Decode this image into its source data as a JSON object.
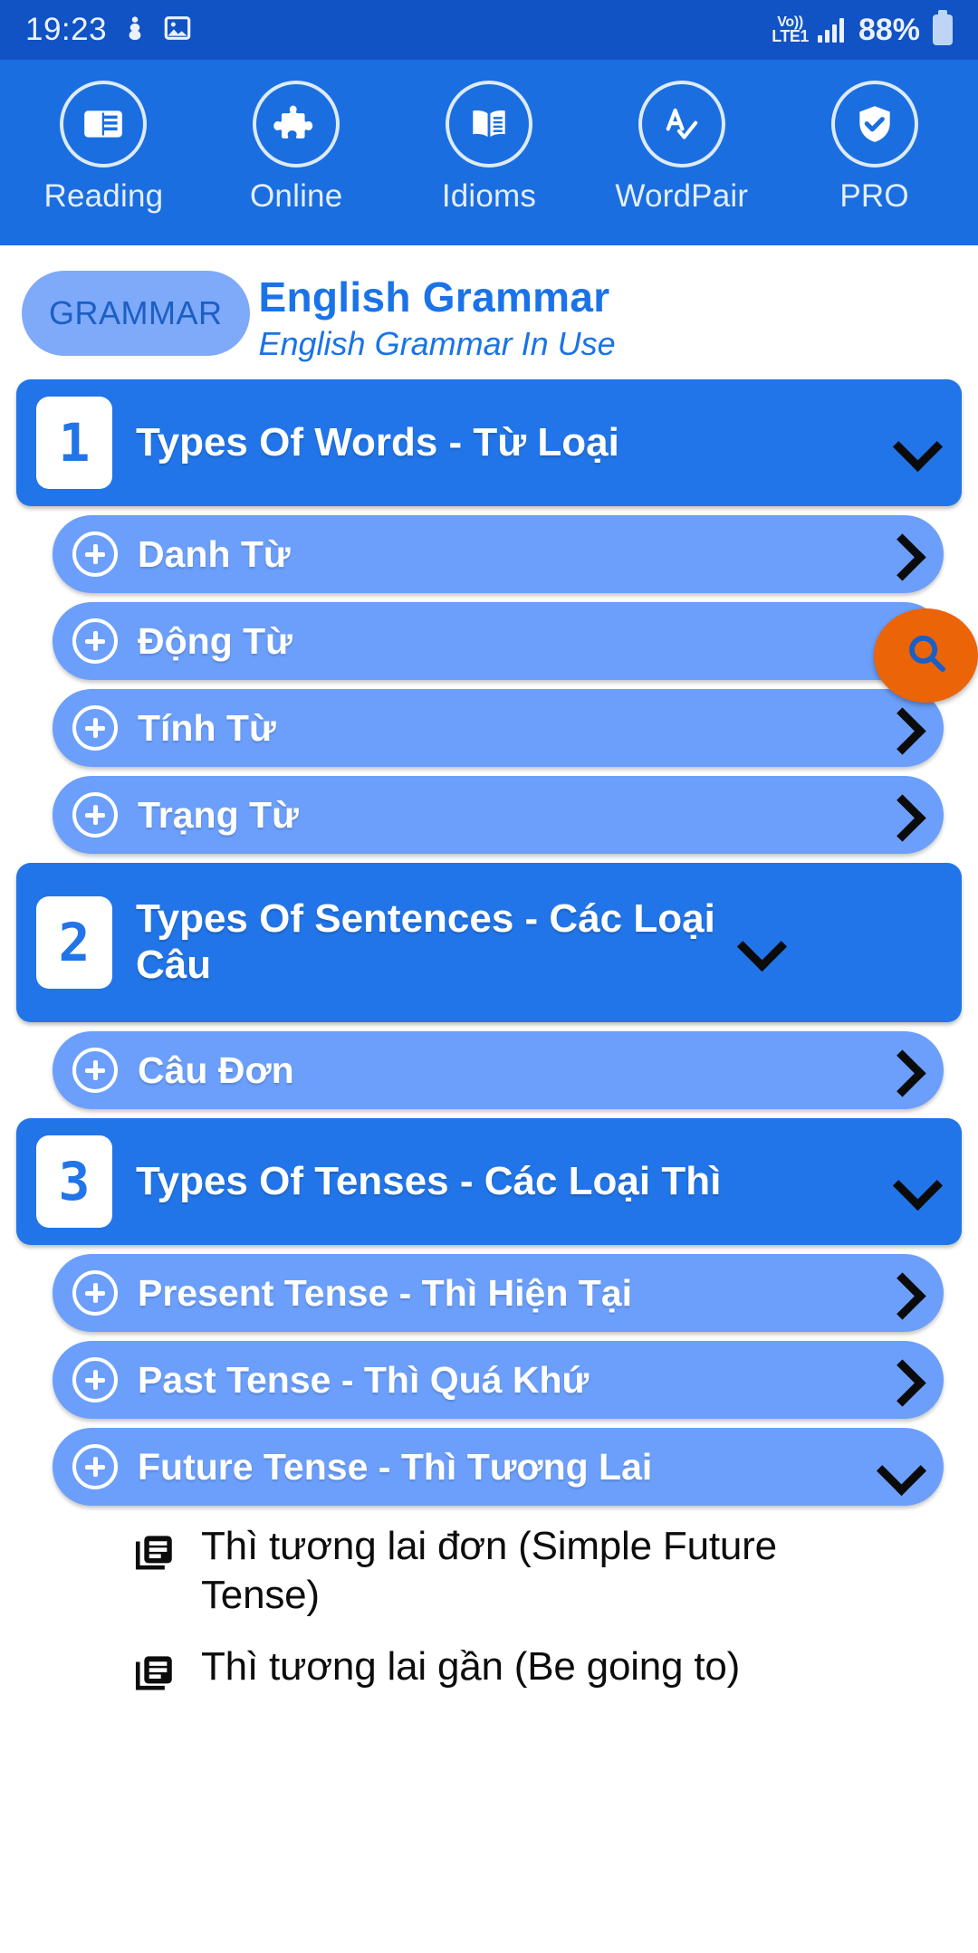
{
  "statusbar": {
    "time": "19:23",
    "icons": [
      "notification-icon",
      "gallery-image-icon"
    ],
    "network_line1": "Vo))",
    "network_line2": "LTE1",
    "battery_percent": "88%"
  },
  "topnav": {
    "items": [
      {
        "label": "Reading",
        "icon": "article-icon"
      },
      {
        "label": "Online",
        "icon": "puzzle-piece-icon"
      },
      {
        "label": "Idioms",
        "icon": "open-book-icon"
      },
      {
        "label": "WordPair",
        "icon": "spellcheck-icon"
      },
      {
        "label": "PRO",
        "icon": "verified-shield-icon"
      }
    ]
  },
  "header": {
    "badge": "GRAMMAR",
    "title": "English Grammar",
    "subtitle": "English Grammar In Use"
  },
  "fab": {
    "icon": "search-icon"
  },
  "sections": [
    {
      "number": "1",
      "title": "Types Of Words - Từ Loại",
      "expanded": true,
      "items": [
        {
          "label": "Danh Từ",
          "state": "collapsed"
        },
        {
          "label": "Động Từ",
          "state": "collapsed"
        },
        {
          "label": "Tính Từ",
          "state": "collapsed"
        },
        {
          "label": "Trạng Từ",
          "state": "collapsed"
        }
      ]
    },
    {
      "number": "2",
      "title": "Types Of Sentences - Các Loại Câu",
      "expanded": true,
      "items": [
        {
          "label": "Câu Đơn",
          "state": "collapsed"
        }
      ]
    },
    {
      "number": "3",
      "title": "Types Of Tenses - Các Loại Thì",
      "expanded": true,
      "items": [
        {
          "label": "Present Tense - Thì Hiện Tại",
          "state": "collapsed"
        },
        {
          "label": "Past Tense - Thì Quá Khứ",
          "state": "collapsed"
        },
        {
          "label": "Future Tense - Thì Tương Lai",
          "state": "expanded",
          "leaves": [
            "Thì tương lai đơn (Simple Future Tense)",
            "Thì tương lai gần (Be going to)"
          ]
        }
      ]
    }
  ],
  "colors": {
    "statusbar": "#1152c4",
    "topnav": "#1a6ee0",
    "section": "#2175e8",
    "subitem": "#6b9ffb",
    "badge": "#7fa9f9",
    "accent_title": "#1a73e8",
    "fab": "#eb6408",
    "fab_icon": "#1a5fc8"
  }
}
